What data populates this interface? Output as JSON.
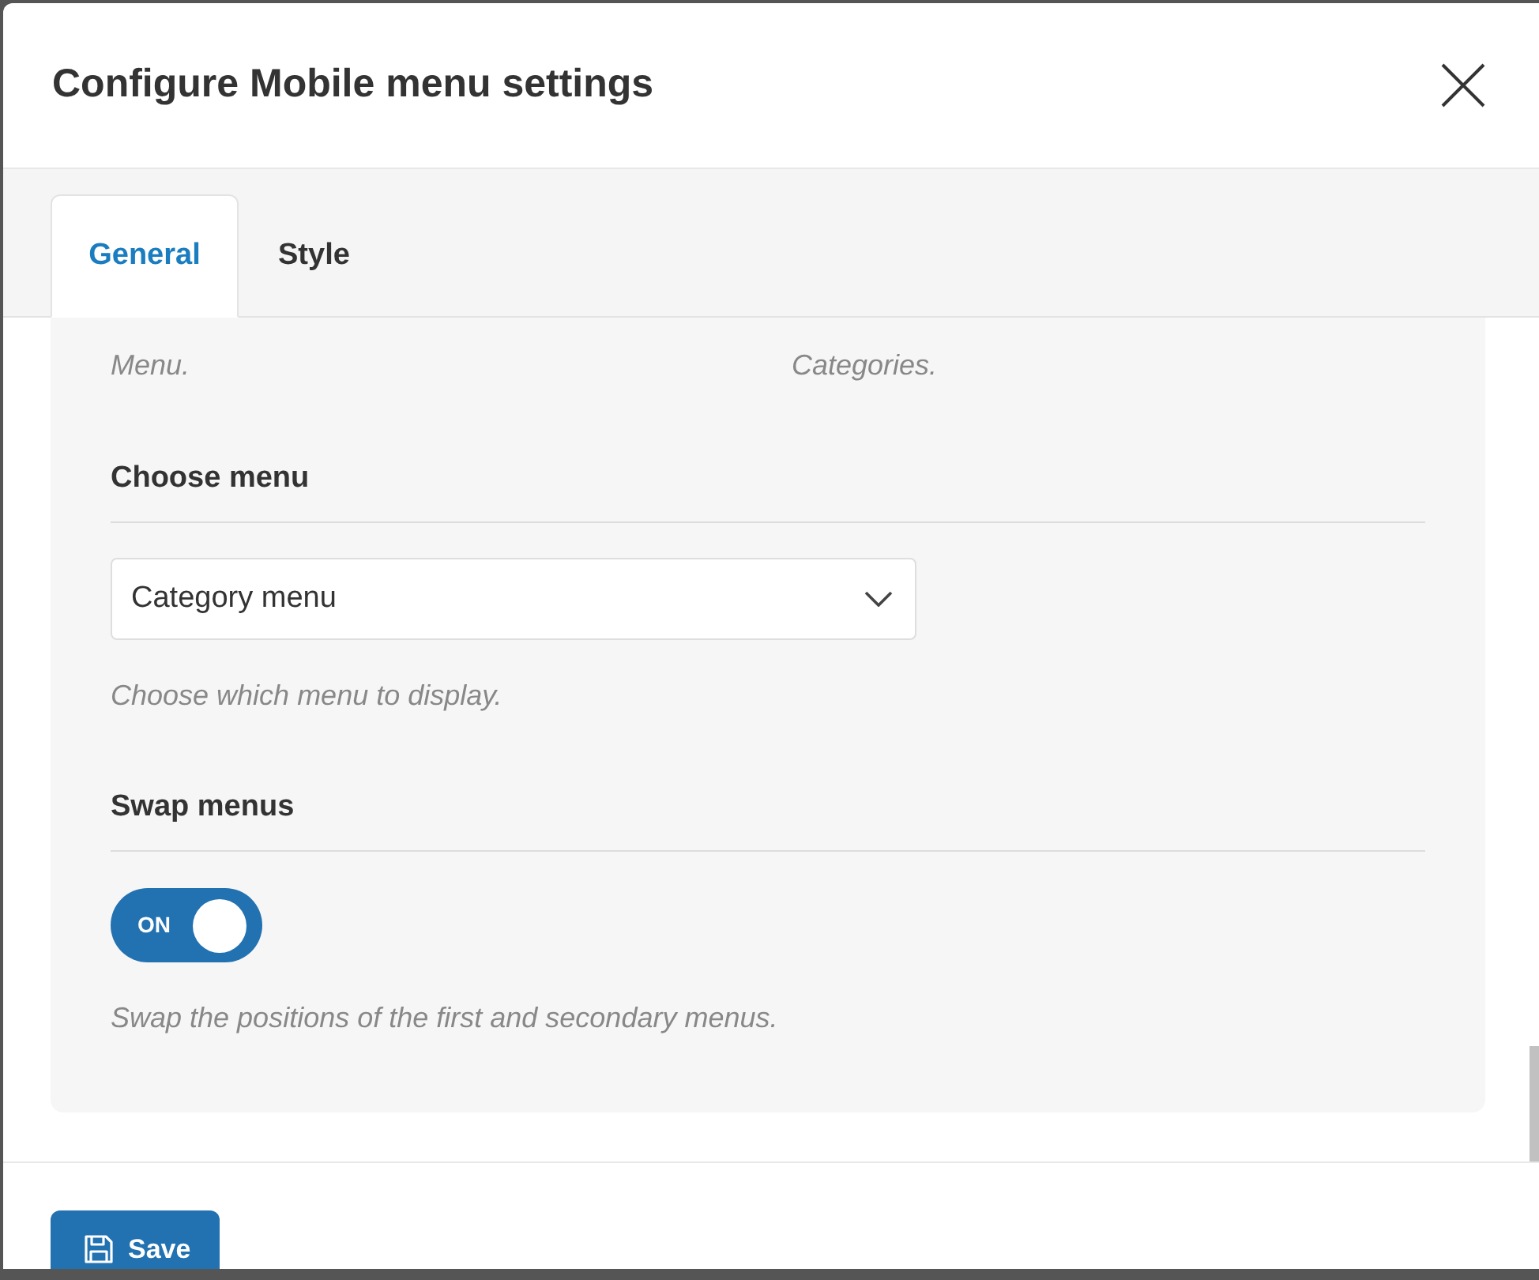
{
  "dialog": {
    "title": "Configure Mobile menu settings"
  },
  "tabs": [
    {
      "label": "General",
      "selected": true
    },
    {
      "label": "Style",
      "selected": false
    }
  ],
  "top_fields": [
    {
      "description": "Menu."
    },
    {
      "description": "Categories."
    }
  ],
  "settings": [
    {
      "kind": "select",
      "label": "Choose menu",
      "value": "Category menu",
      "help": "Choose which menu to display."
    },
    {
      "kind": "toggle",
      "label": "Swap menus",
      "on": true,
      "state_label": "ON",
      "help": "Swap the positions of the first and secondary menus."
    }
  ],
  "footer": {
    "buttons": [
      {
        "label": "Save"
      }
    ]
  }
}
